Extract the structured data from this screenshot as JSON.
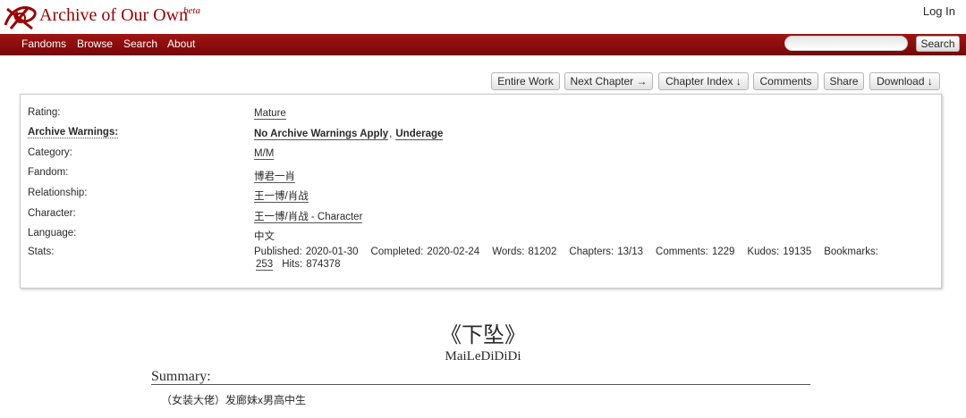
{
  "header": {
    "site_title": "Archive of Our Own",
    "beta": "beta",
    "login": "Log In"
  },
  "nav": {
    "items": [
      "Fandoms",
      "Browse",
      "Search",
      "About"
    ],
    "search_button": "Search",
    "search_placeholder": ""
  },
  "actions": [
    "Entire Work",
    "Next Chapter →",
    "Chapter Index ↓",
    "Comments",
    "Share",
    "Download ↓"
  ],
  "meta": {
    "rating": {
      "label": "Rating:",
      "value": "Mature"
    },
    "warnings": {
      "label": "Archive Warnings:",
      "values": [
        "No Archive Warnings Apply",
        "Underage"
      ]
    },
    "category": {
      "label": "Category:",
      "value": "M/M"
    },
    "fandom": {
      "label": "Fandom:",
      "value": "博君一肖"
    },
    "relationship": {
      "label": "Relationship:",
      "value": "王一博/肖战"
    },
    "character": {
      "label": "Character:",
      "value": "王一博/肖战 - Character"
    },
    "language": {
      "label": "Language:",
      "value": "中文"
    },
    "stats": {
      "label": "Stats:",
      "published_label": "Published:",
      "published": "2020-01-30",
      "completed_label": "Completed:",
      "completed": "2020-02-24",
      "words_label": "Words:",
      "words": "81202",
      "chapters_label": "Chapters:",
      "chapters": "13/13",
      "comments_label": "Comments:",
      "comments": "1229",
      "kudos_label": "Kudos:",
      "kudos": "19135",
      "bookmarks_label": "Bookmarks:",
      "bookmarks": "253",
      "hits_label": "Hits:",
      "hits": "874378"
    }
  },
  "work": {
    "title": "《下坠》",
    "author": "MaiLeDiDiDi",
    "summary_heading": "Summary:",
    "summary": "（女装大佬）发廊妹x男高中生"
  },
  "colors": {
    "brand": "#990000",
    "nav_bg": "#8f0f0f"
  }
}
